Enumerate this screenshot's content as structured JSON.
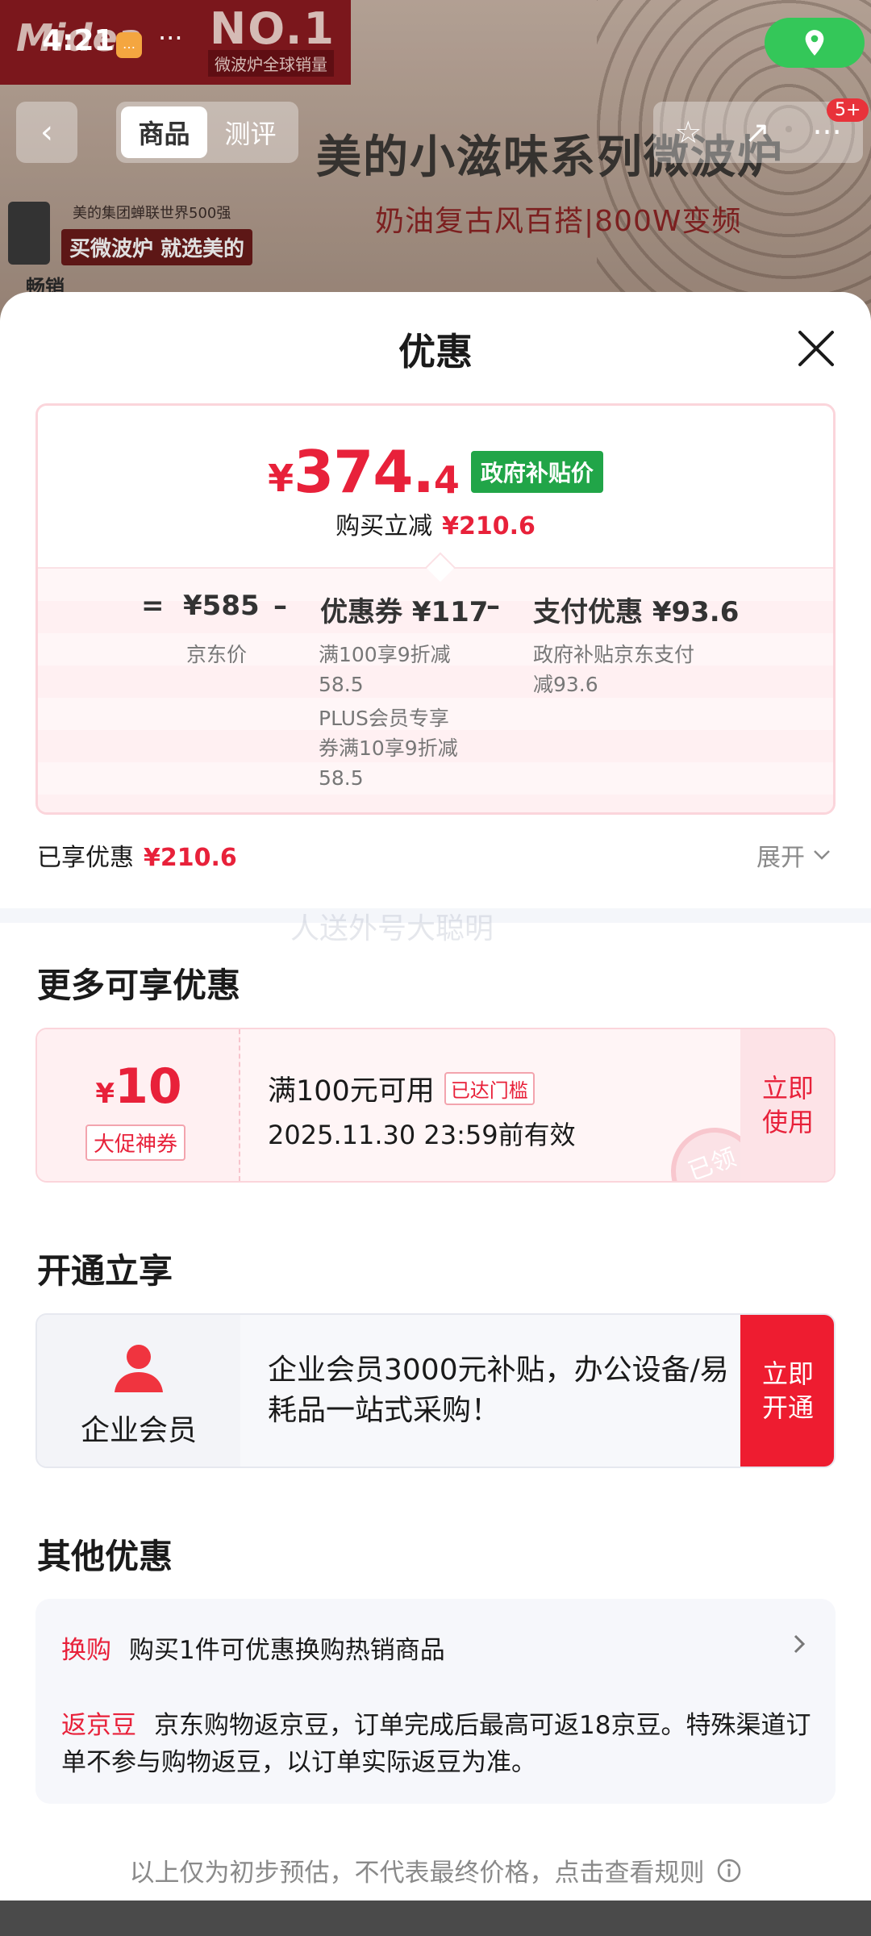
{
  "status_bar": {
    "time": "4:21",
    "dots": "···"
  },
  "background": {
    "brand": "Midea",
    "banner_big": "NO.1",
    "banner_small": "微波炉全球销量",
    "product_title": "美的小滋味系列微波炉",
    "product_subtitle": "奶油复古风百搭|800W变频",
    "fortune_text": "美的集团蝉联世界500强",
    "buy_text": "买微波炉 就选美的",
    "sales_text": "畅销",
    "badge": "5+"
  },
  "nav": {
    "tabs": [
      {
        "label": "商品"
      },
      {
        "label": "测评"
      }
    ]
  },
  "sheet": {
    "title": "优惠"
  },
  "price": {
    "currency": "¥",
    "integer": "374.",
    "decimal": "4",
    "badge": "政府补贴价",
    "direct_off_label": "购买立减",
    "direct_off_value": "¥210.6"
  },
  "calc": {
    "equals": "=",
    "base": {
      "value": "¥585",
      "label": "京东价"
    },
    "minus": "–",
    "coupon": {
      "value": "优惠券 ¥117",
      "line1": "满100享9折减",
      "line2": "58.5",
      "line3": "PLUS会员专享",
      "line4": "券满10享9折减",
      "line5": "58.5"
    },
    "pay": {
      "value": "支付优惠 ¥93.6",
      "line1": "政府补贴京东支付",
      "line2": "减93.6"
    }
  },
  "enjoyed": {
    "label": "已享优惠",
    "value": "¥210.6",
    "expand": "展开"
  },
  "watermark": "人送外号大聪明",
  "more_offers": {
    "title": "更多可享优惠",
    "coupon": {
      "currency": "¥",
      "amount": "10",
      "tag": "大促神券",
      "condition": "满100元可用",
      "reach": "已达门槛",
      "expiry": "2025.11.30 23:59前有效",
      "stamp": "已领",
      "button_line1": "立即",
      "button_line2": "使用"
    }
  },
  "open_section": {
    "title": "开通立享",
    "label": "企业会员",
    "desc": "企业会员3000元补贴，办公设备/易耗品一站式采购！",
    "button_line1": "立即",
    "button_line2": "开通"
  },
  "other": {
    "title": "其他优惠",
    "row1_key": "换购",
    "row1_text": "购买1件可优惠换购热销商品",
    "row2_key": "返京豆",
    "row2_text": "京东购物返京豆，订单完成后最高可返18京豆。特殊渠道订单不参与购物返豆，以订单实际返豆为准。"
  },
  "footer": "以上仅为初步预估，不代表最终价格，点击查看规则",
  "colors": {
    "accent_red": "#e8213a",
    "gov_green": "#21a548",
    "location_green": "#34c759"
  }
}
